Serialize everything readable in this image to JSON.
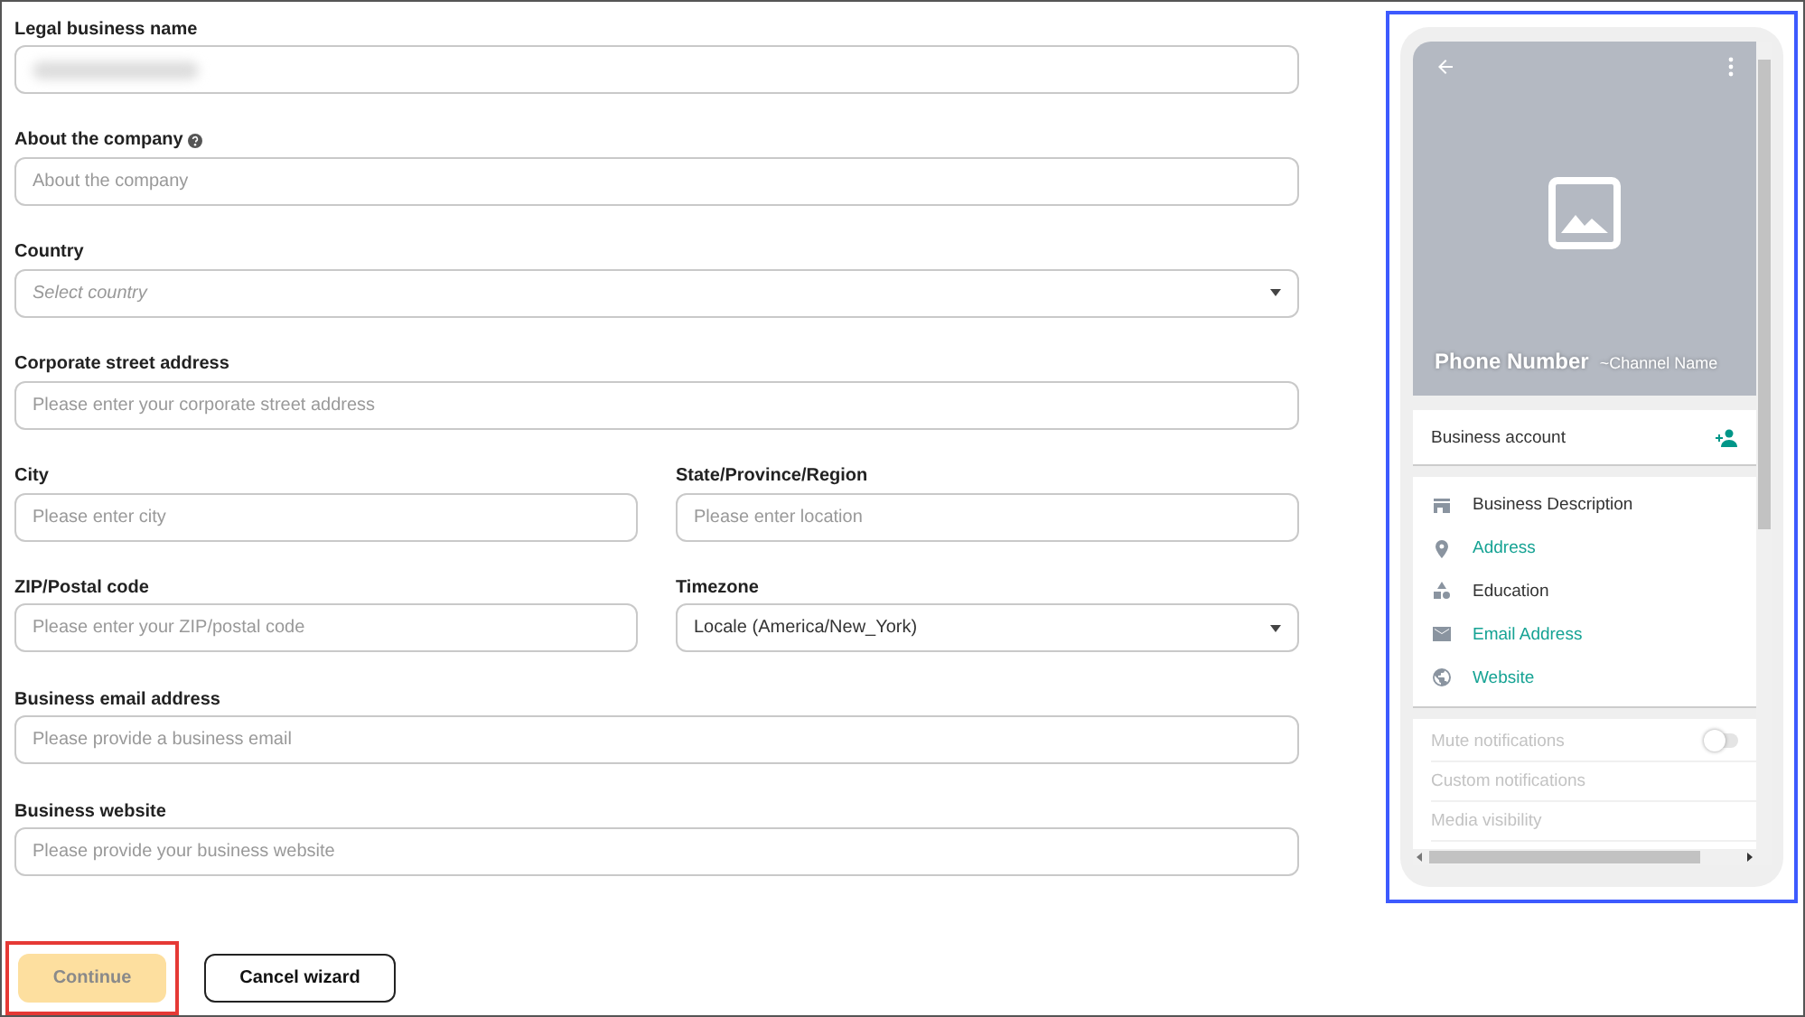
{
  "form": {
    "rows": [
      {
        "fields": [
          {
            "label": "Legal business name",
            "kind": "blurred"
          }
        ]
      },
      {
        "fields": [
          {
            "label": "About the company",
            "kind": "text",
            "placeholder": "About the company",
            "help": true
          }
        ]
      },
      {
        "fields": [
          {
            "label": "Country",
            "kind": "select",
            "placeholder": "Select country"
          }
        ]
      },
      {
        "fields": [
          {
            "label": "Corporate street address",
            "kind": "text",
            "placeholder": "Please enter your corporate street address"
          }
        ]
      },
      {
        "fields": [
          {
            "label": "City",
            "kind": "text",
            "placeholder": "Please enter city"
          },
          {
            "label": "State/Province/Region",
            "kind": "text",
            "placeholder": "Please enter location"
          }
        ]
      },
      {
        "fields": [
          {
            "label": "ZIP/Postal code",
            "kind": "text",
            "placeholder": "Please enter your ZIP/postal code"
          },
          {
            "label": "Timezone",
            "kind": "select",
            "value": "Locale (America/New_York)"
          }
        ]
      },
      {
        "fields": [
          {
            "label": "Business email address",
            "kind": "text",
            "placeholder": "Please provide a business email"
          }
        ]
      },
      {
        "fields": [
          {
            "label": "Business website",
            "kind": "text",
            "placeholder": "Please provide your business website"
          }
        ]
      }
    ]
  },
  "actions": [
    {
      "label": "Continue",
      "kind": "primary",
      "disabled": true,
      "highlighted": true
    },
    {
      "label": "Cancel wizard",
      "kind": "secondary",
      "disabled": false,
      "highlighted": false
    }
  ],
  "preview": {
    "title": "Phone Number",
    "subtitle": "~Channel Name",
    "account": {
      "label": "Business account"
    },
    "info": [
      {
        "label": "Business Description",
        "link": false
      },
      {
        "label": "Address",
        "link": true
      },
      {
        "label": "Education",
        "link": false
      },
      {
        "label": "Email Address",
        "link": true
      },
      {
        "label": "Website",
        "link": true
      }
    ],
    "settings": [
      {
        "label": "Mute notifications",
        "kind": "toggle",
        "on": false
      },
      {
        "label": "Custom notifications",
        "kind": "plain"
      },
      {
        "label": "Media visibility",
        "kind": "plain"
      }
    ]
  }
}
